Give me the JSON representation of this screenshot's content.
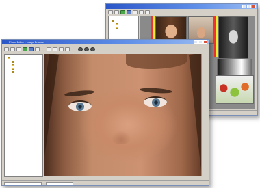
{
  "back_window": {
    "tree_items": [
      "",
      "",
      ""
    ],
    "status_text": ""
  },
  "front_window": {
    "title": "Photo Editor - Image Browser",
    "tree_items": [
      {
        "label": "",
        "level": 0
      },
      {
        "label": "",
        "level": 1
      },
      {
        "label": "",
        "level": 1
      },
      {
        "label": "",
        "level": 1
      },
      {
        "label": "",
        "level": 1
      }
    ],
    "status_left": "",
    "status_right": ""
  },
  "toolbar_icons": [
    "open-icon",
    "save-icon",
    "print-icon",
    "zoom-in-icon",
    "zoom-out-icon",
    "rotate-icon",
    "crop-icon",
    "brightness-icon",
    "contrast-icon",
    "filter-icon",
    "settings-icon"
  ],
  "colors": {
    "title_bar": "#2a56c8",
    "chrome": "#d4d0c8",
    "viewer_bg": "#7a7a7a"
  }
}
